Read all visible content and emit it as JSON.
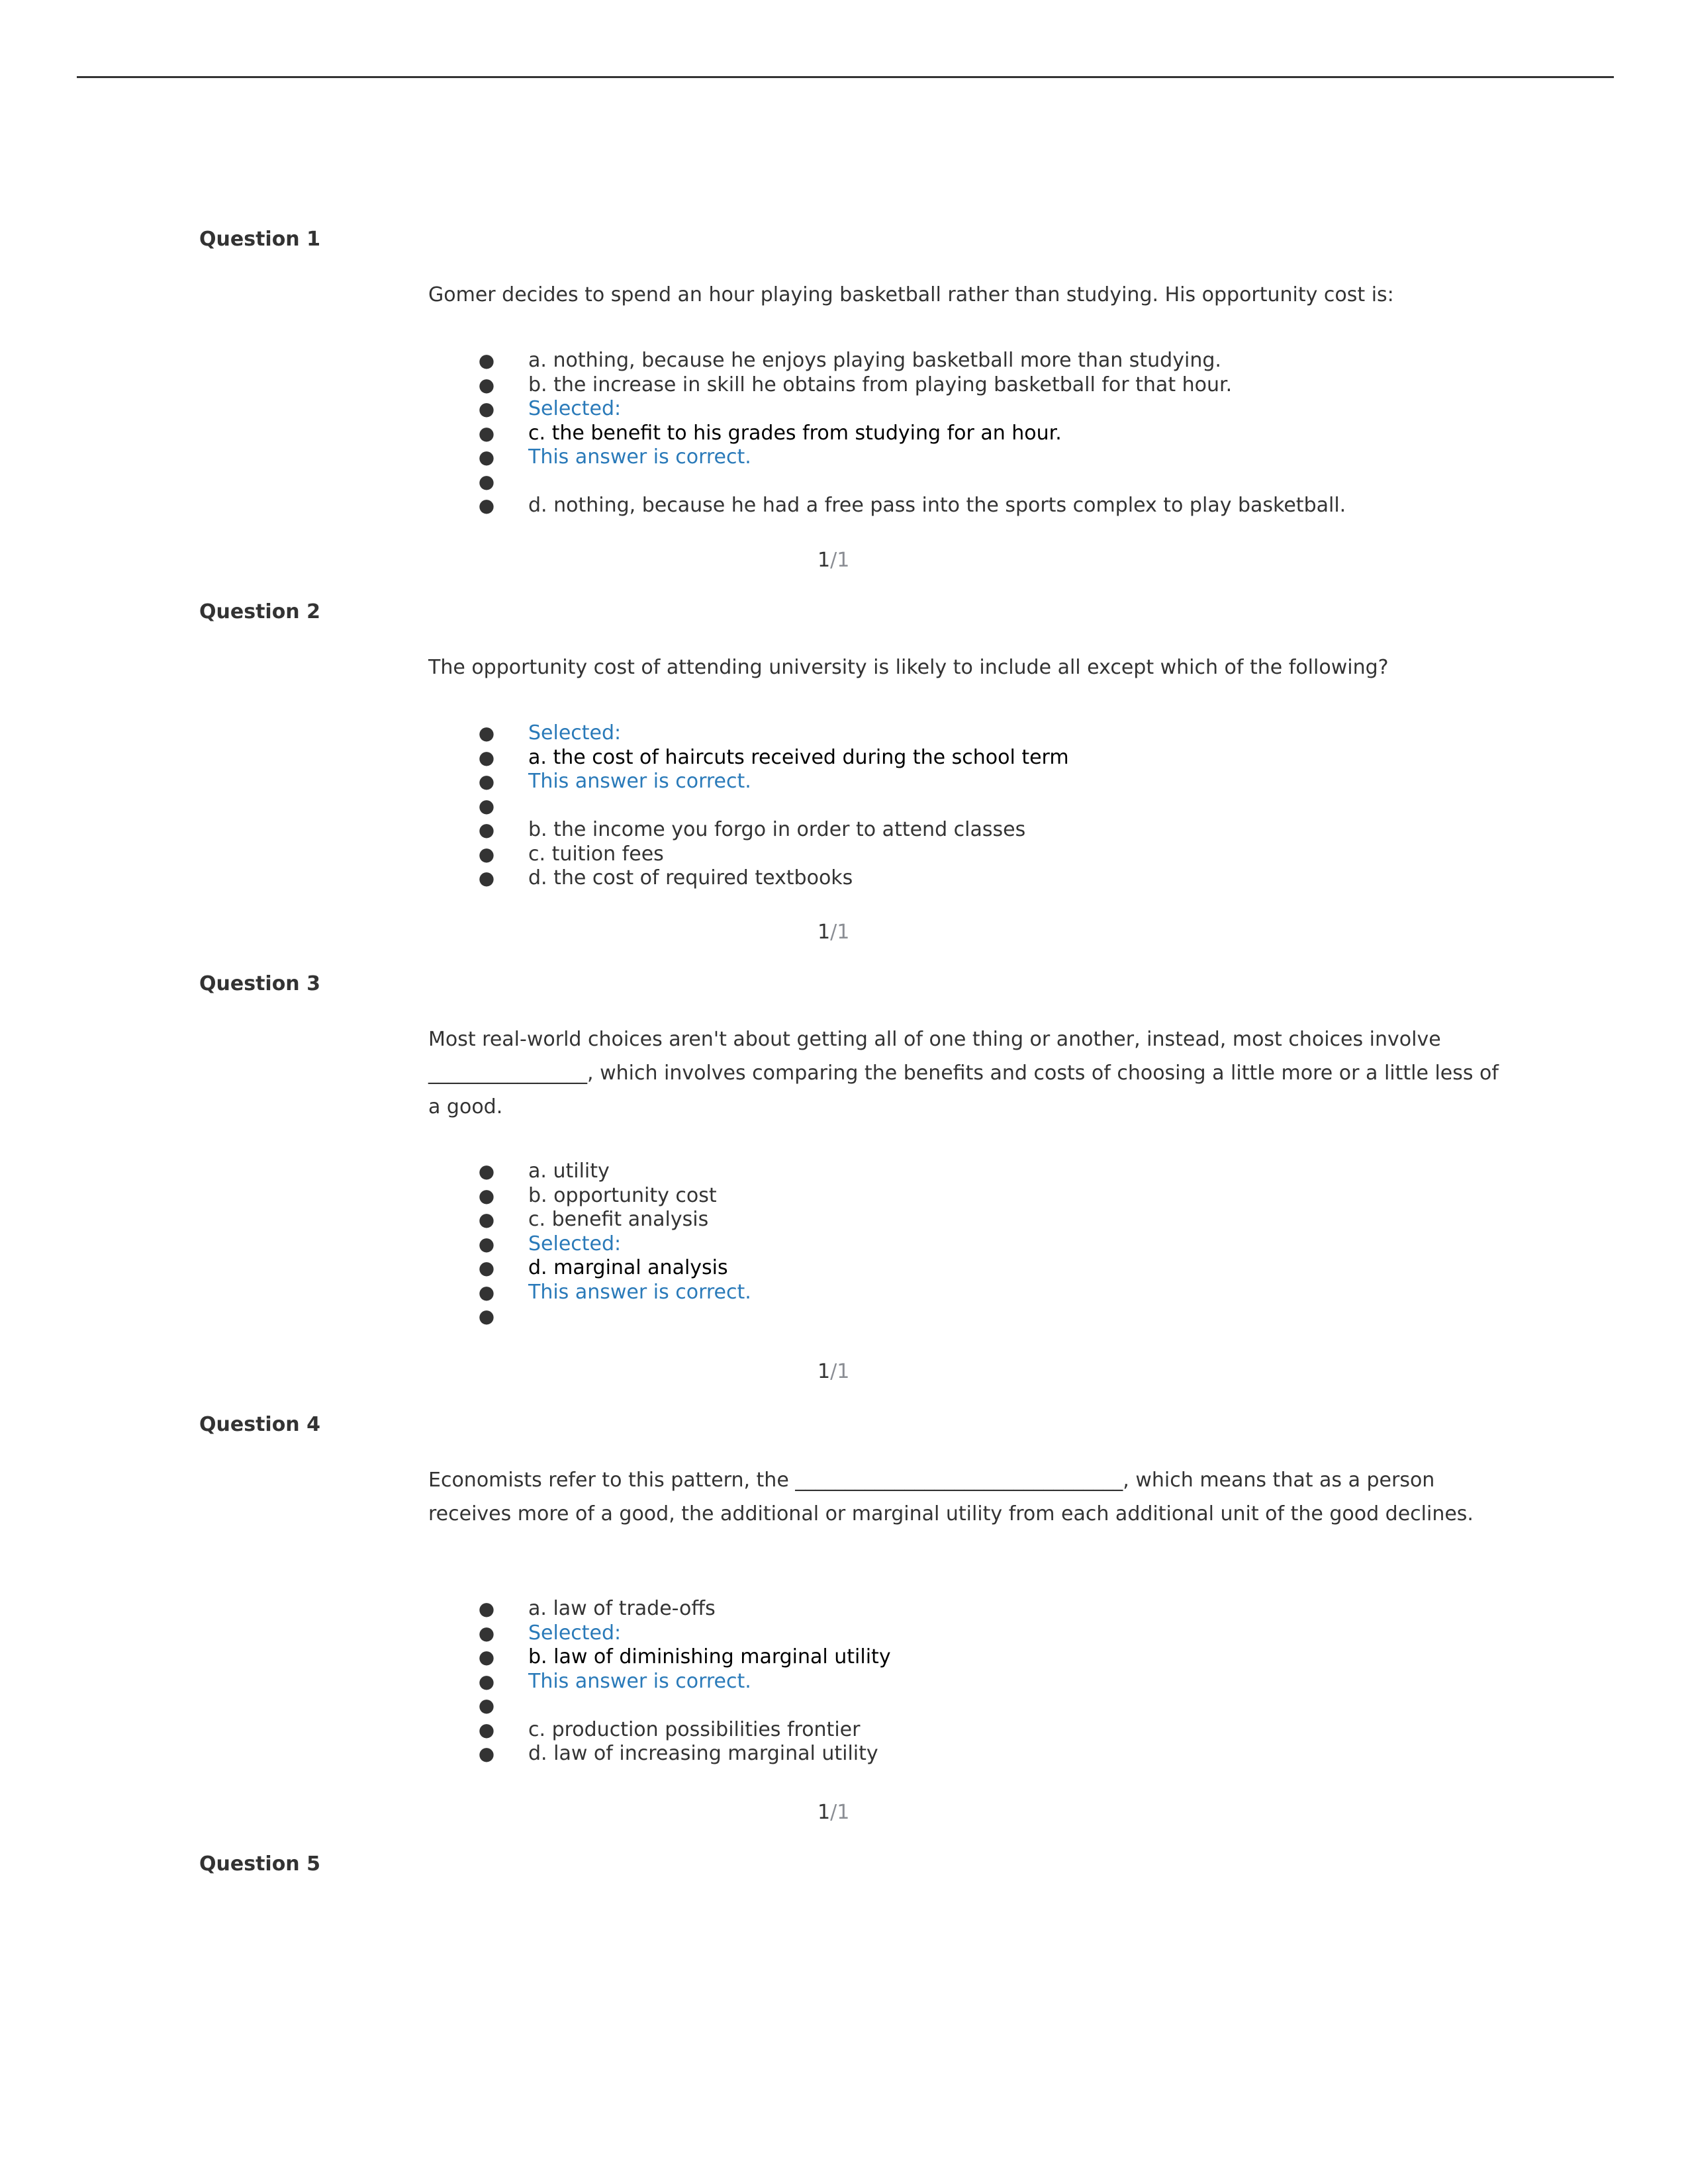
{
  "questions": [
    {
      "title": "Question 1",
      "text": "Gomer decides to spend an hour playing basketball rather than studying. His opportunity cost is:",
      "options": [
        {
          "text": "a. nothing, because he enjoys playing basketball more than studying.",
          "kind": "normal"
        },
        {
          "text": "b. the increase in skill he obtains from playing basketball for that hour.",
          "kind": "normal"
        },
        {
          "text": "Selected:",
          "kind": "label"
        },
        {
          "text": "c. the benefit to his grades from studying for an hour.",
          "kind": "selected"
        },
        {
          "text": "This answer is correct.",
          "kind": "label"
        },
        {
          "text": "",
          "kind": "normal"
        },
        {
          "text": "d. nothing, because he had a free pass into the sports complex to play basketball.",
          "kind": "normal"
        }
      ],
      "score": {
        "earned": "1",
        "sep": "/",
        "max": "1"
      }
    },
    {
      "title": "Question 2",
      "text": "The opportunity cost of attending university is likely to include all except which of the following?",
      "options": [
        {
          "text": "Selected:",
          "kind": "label"
        },
        {
          "text": "a. the cost of haircuts received during the school term",
          "kind": "selected"
        },
        {
          "text": "This answer is correct.",
          "kind": "label"
        },
        {
          "text": "",
          "kind": "normal"
        },
        {
          "text": "b. the income you forgo in order to attend classes",
          "kind": "normal"
        },
        {
          "text": "c. tuition fees",
          "kind": "normal"
        },
        {
          "text": "d. the cost of required textbooks",
          "kind": "normal"
        }
      ],
      "score": {
        "earned": "1",
        "sep": "/",
        "max": "1"
      }
    },
    {
      "title": "Question 3",
      "text": "Most real-world choices aren't about getting all of one thing or another, instead, most choices involve ________________, which involves comparing the benefits and costs of choosing a little more or a little less of a good.",
      "options": [
        {
          "text": "a. utility",
          "kind": "normal"
        },
        {
          "text": "b. opportunity cost",
          "kind": "normal"
        },
        {
          "text": "c. benefit analysis",
          "kind": "normal"
        },
        {
          "text": "Selected:",
          "kind": "label"
        },
        {
          "text": "d. marginal analysis",
          "kind": "selected"
        },
        {
          "text": "This answer is correct.",
          "kind": "label"
        },
        {
          "text": "",
          "kind": "normal"
        }
      ],
      "score": {
        "earned": "1",
        "sep": "/",
        "max": "1"
      }
    },
    {
      "title": "Question 4",
      "text": "Economists refer to this pattern, the _________________________________, which means that as a person receives more of a good, the additional or marginal utility from each additional unit of the good declines.",
      "options": [
        {
          "text": "a. law of trade-offs",
          "kind": "normal"
        },
        {
          "text": "Selected:",
          "kind": "label"
        },
        {
          "text": "b. law of diminishing marginal utility",
          "kind": "selected"
        },
        {
          "text": "This answer is correct.",
          "kind": "label"
        },
        {
          "text": "",
          "kind": "normal"
        },
        {
          "text": "c. production possibilities frontier",
          "kind": "normal"
        },
        {
          "text": "d. law of increasing marginal utility",
          "kind": "normal"
        }
      ],
      "score": {
        "earned": "1",
        "sep": "/",
        "max": "1"
      }
    },
    {
      "title": "Question 5"
    }
  ],
  "colors": {
    "label_blue": "#2a7ab9",
    "text": "#333333",
    "score_max": "#8a8d93"
  }
}
